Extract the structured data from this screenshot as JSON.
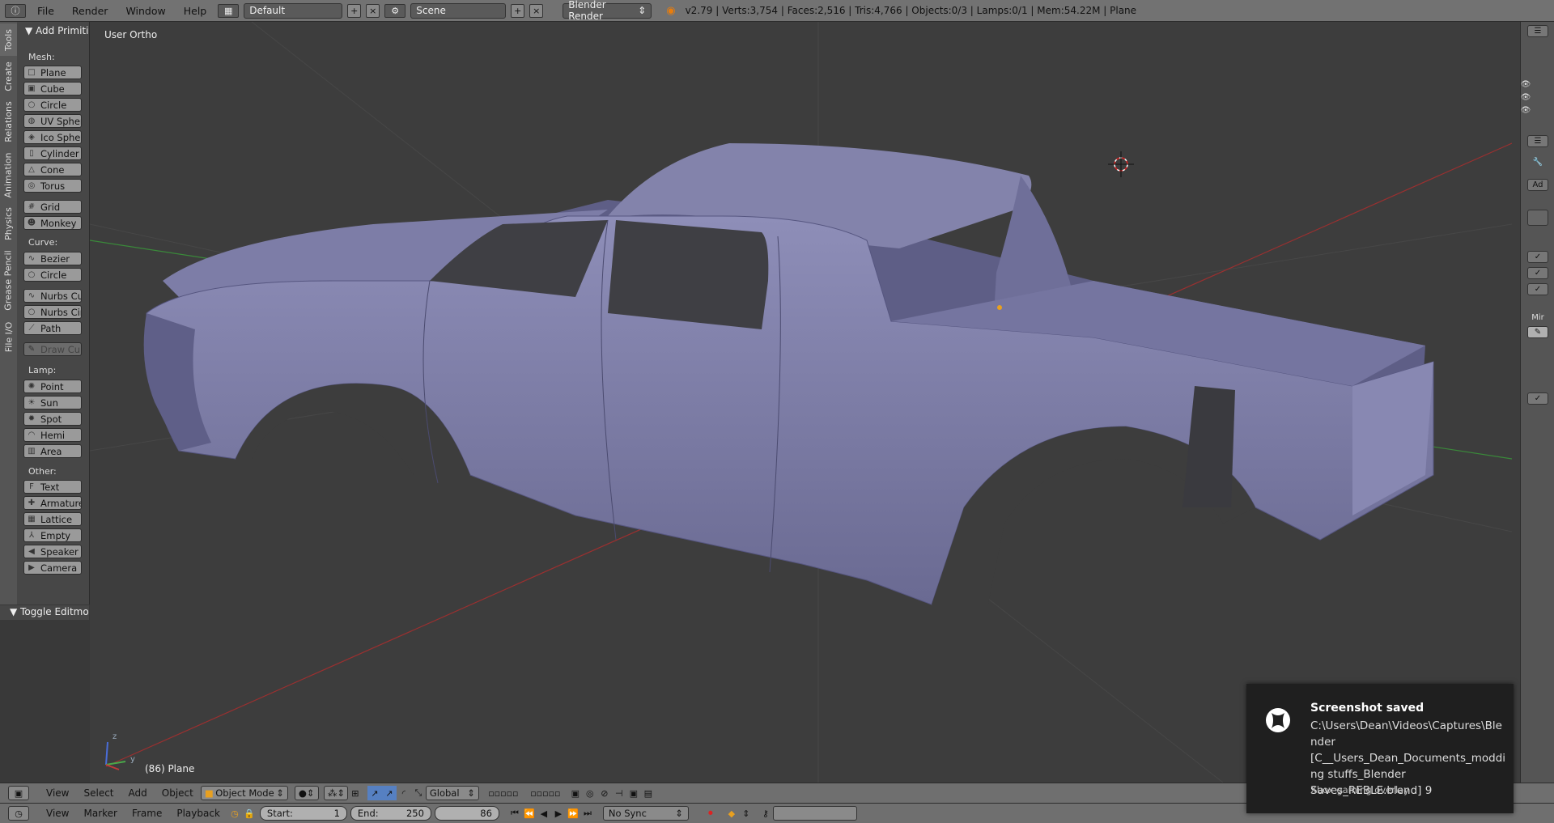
{
  "topbar": {
    "menus": [
      "File",
      "Render",
      "Window",
      "Help"
    ],
    "layout": "Default",
    "scene": "Scene",
    "engine": "Blender Render",
    "stats": "v2.79 | Verts:3,754 | Faces:2,516 | Tris:4,766 | Objects:0/3 | Lamps:0/1 | Mem:54.22M | Plane"
  },
  "left_tabs": [
    "Tools",
    "Create",
    "Relations",
    "Animation",
    "Physics",
    "Grease Pencil",
    "File I/O"
  ],
  "toolshelf": {
    "title": "Add Primiti",
    "mesh_label": "Mesh:",
    "mesh": [
      "Plane",
      "Cube",
      "Circle",
      "UV Sphere",
      "Ico Sphere",
      "Cylinder",
      "Cone",
      "Torus"
    ],
    "mesh2": [
      "Grid",
      "Monkey"
    ],
    "curve_label": "Curve:",
    "curve": [
      "Bezier",
      "Circle"
    ],
    "curve2": [
      "Nurbs Curv",
      "Nurbs Circl",
      "Path"
    ],
    "draw_curve": "Draw Curv",
    "lamp_label": "Lamp:",
    "lamp": [
      "Point",
      "Sun",
      "Spot",
      "Hemi",
      "Area"
    ],
    "other_label": "Other:",
    "other": [
      "Text",
      "Armature",
      "Lattice",
      "Empty",
      "Speaker",
      "Camera"
    ],
    "toggle": "Toggle Editmo"
  },
  "viewport": {
    "view_name": "User Ortho",
    "object_info": "(86) Plane",
    "axis_z": "z",
    "axis_y": "y"
  },
  "right_panel": {
    "ad": "Ad",
    "mir": "Mir"
  },
  "header3d": {
    "menus": [
      "View",
      "Select",
      "Add",
      "Object"
    ],
    "mode": "Object Mode",
    "orientation": "Global"
  },
  "timeline": {
    "menus": [
      "View",
      "Marker",
      "Frame",
      "Playback"
    ],
    "start_label": "Start:",
    "start": "1",
    "end_label": "End:",
    "end": "250",
    "current": "86",
    "sync": "No Sync"
  },
  "toast": {
    "title": "Screenshot saved",
    "body": "C:\\Users\\Dean\\Videos\\Captures\\Blender [C__Users_Dean_Documents_modding stuffs_Blender Saves_REBLE.blend] 9",
    "source": "Xbox gaming overlay"
  },
  "colors": {
    "truck": "#7a7aa4",
    "grid_bg": "#3d3d3d",
    "x_axis": "#b03030",
    "y_axis": "#3a9a3a",
    "toast_bg": "#1f1f1f"
  }
}
